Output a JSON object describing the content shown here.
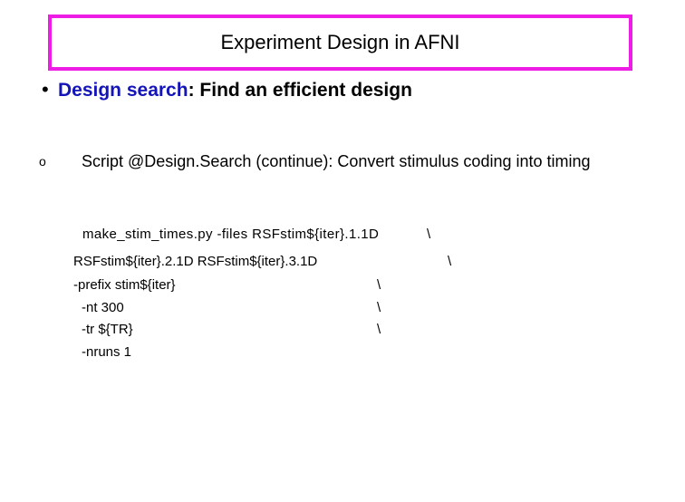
{
  "title": "Experiment Design in AFNI",
  "bullet": {
    "highlight": "Design search",
    "rest": ": Find an efficient design"
  },
  "sub_bullet": "Script @Design.Search (continue): Convert stimulus coding into timing",
  "code_lines": [
    "make_stim_times.py -files RSFstim${iter}.1.1D",
    "RSFstim${iter}.2.1D RSFstim${iter}.3.1D",
    "-prefix stim${iter}",
    "-nt 300",
    "-tr ${TR}",
    "-nruns 1"
  ],
  "line_continuation": "\\"
}
